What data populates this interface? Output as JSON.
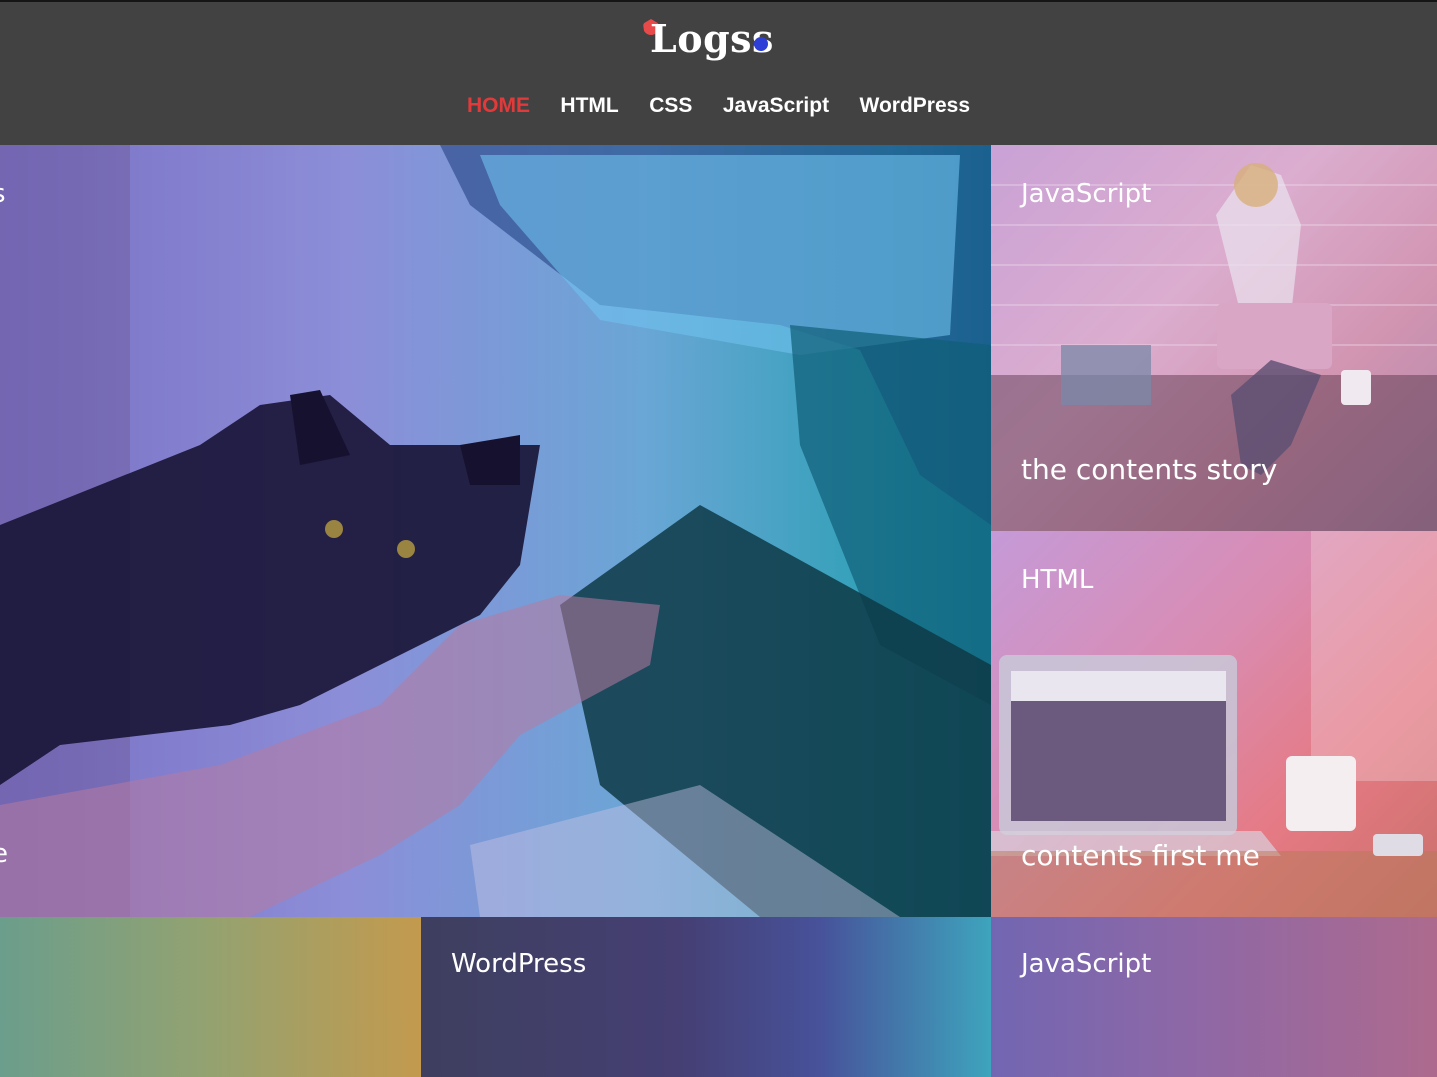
{
  "header": {
    "logo_text": "Logss"
  },
  "nav": {
    "items": [
      {
        "label": "HOME",
        "active": true
      },
      {
        "label": "HTML",
        "active": false
      },
      {
        "label": "CSS",
        "active": false
      },
      {
        "label": "JavaScript",
        "active": false
      },
      {
        "label": "WordPress",
        "active": false
      }
    ]
  },
  "colors": {
    "header_bg": "#424242",
    "nav_active": "#e23a3a",
    "logo_accent_red": "#e84a4a",
    "logo_accent_blue": "#2d3fd6"
  },
  "tiles": {
    "hero": {
      "category_partial": "s",
      "title_partial": "e"
    },
    "right_top": {
      "category": "JavaScript",
      "title": "the contents story"
    },
    "right_middle": {
      "category": "HTML",
      "title": "contents first me"
    },
    "bottom_middle": {
      "category": "WordPress"
    },
    "bottom_right": {
      "category": "JavaScript"
    }
  }
}
